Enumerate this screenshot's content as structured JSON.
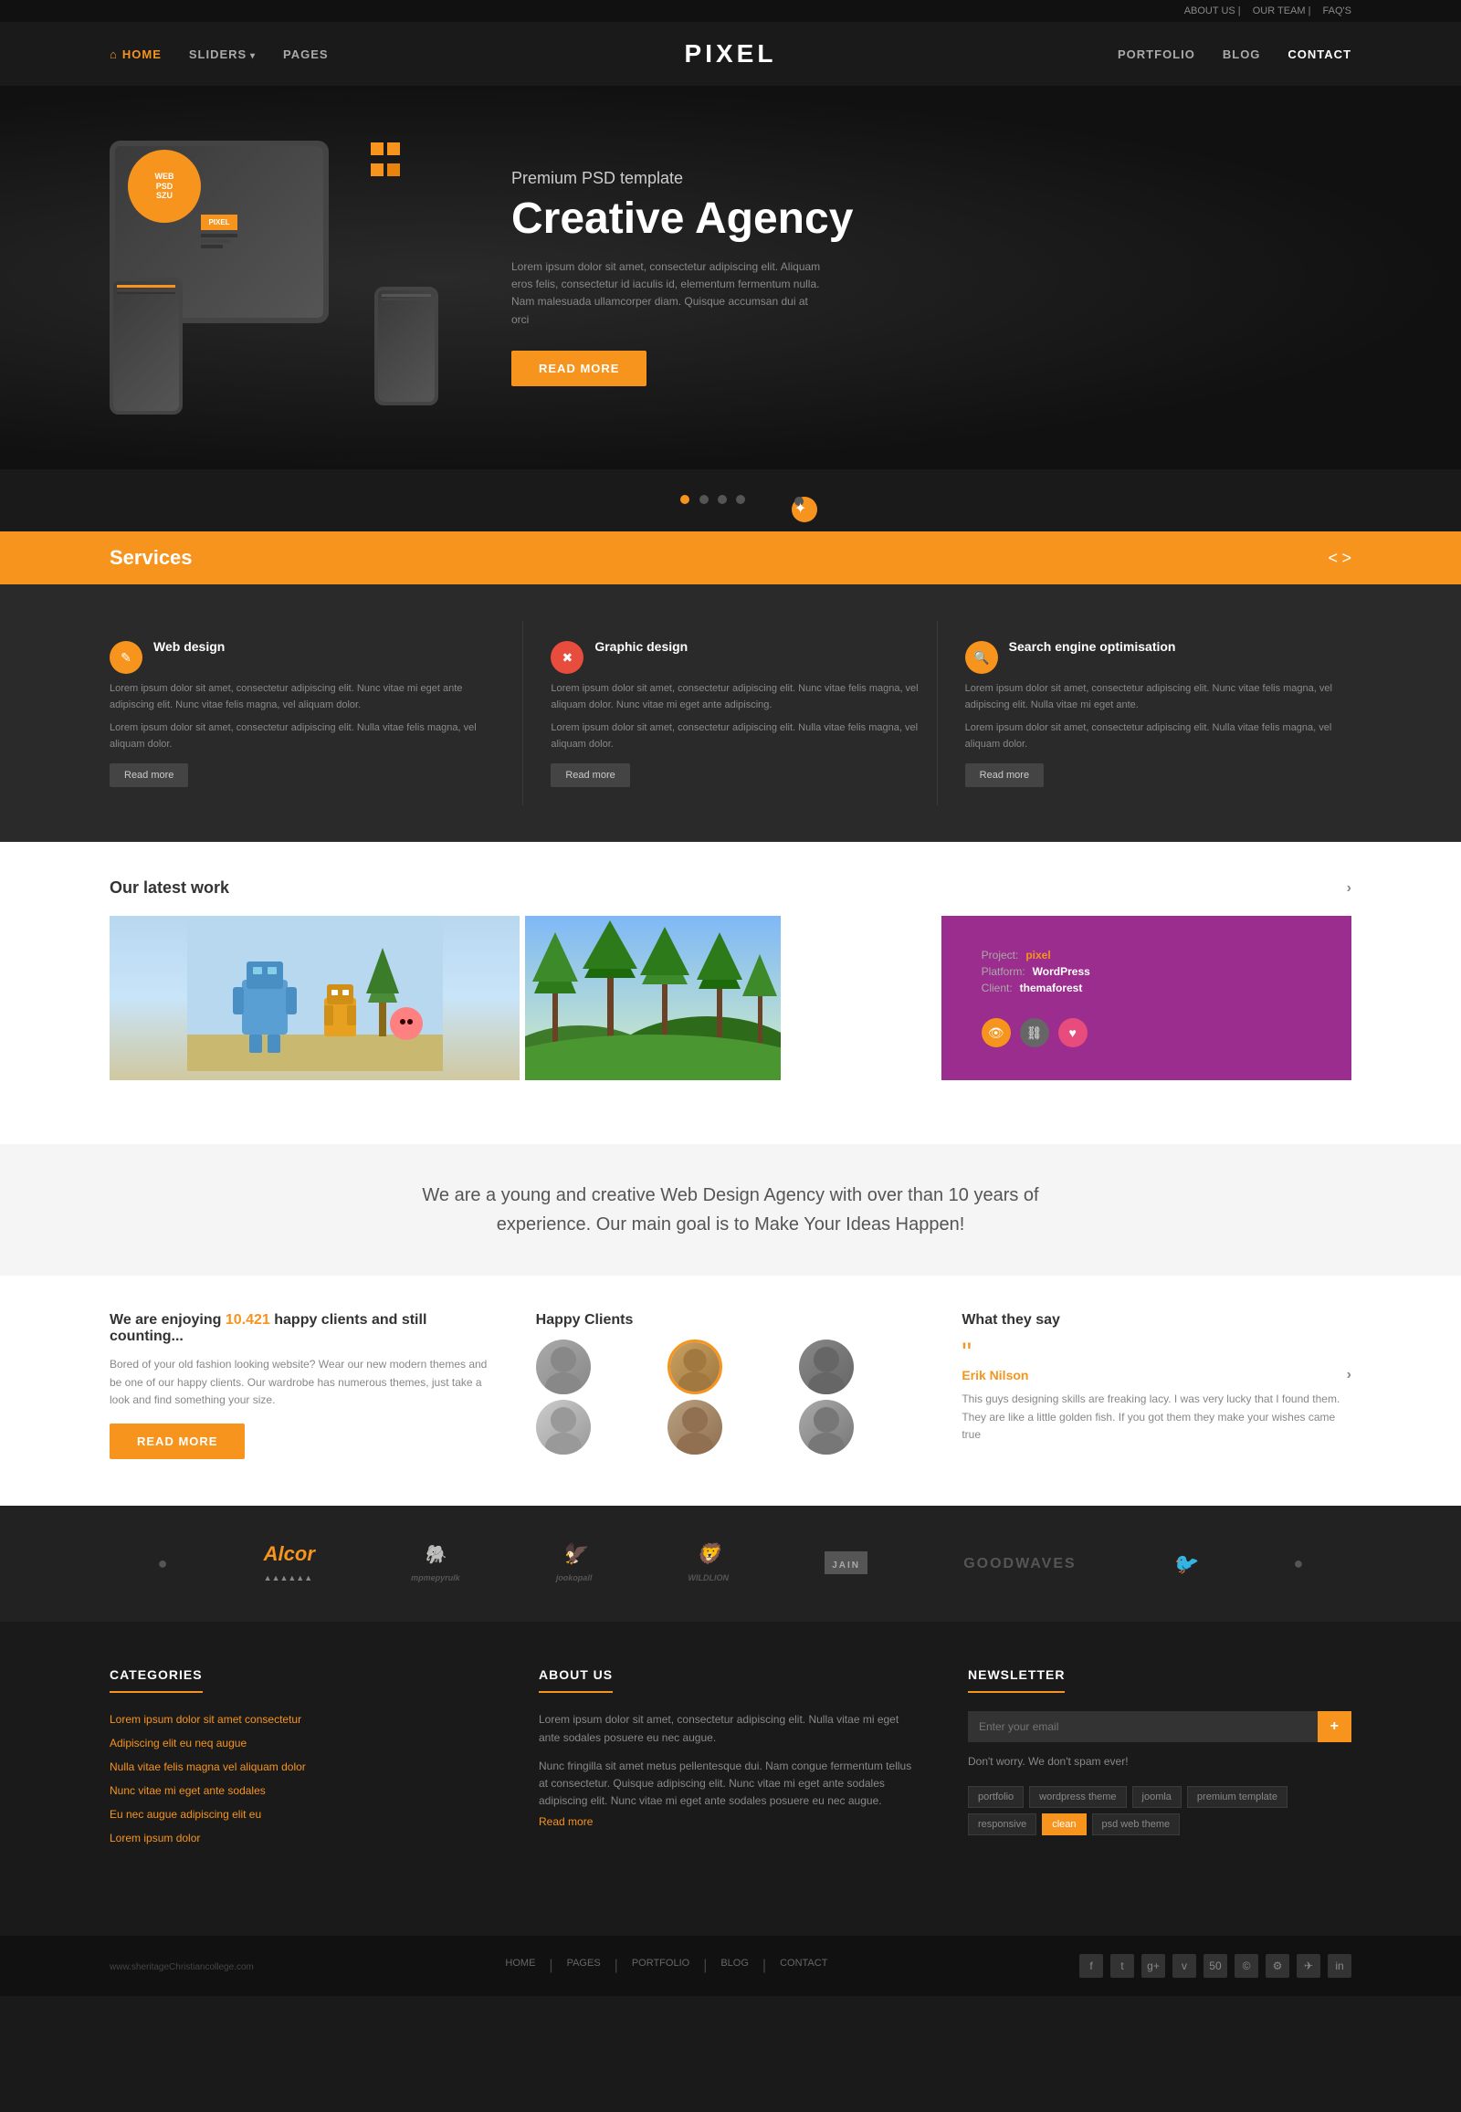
{
  "topbar": {
    "links": [
      "ABOUT US",
      "OUR TEAM",
      "FAQ'S"
    ]
  },
  "nav": {
    "home": "HOME",
    "sliders": "SLIDERS",
    "pages": "PAGES",
    "logo": "PIXEL",
    "portfolio": "PORTFOLIO",
    "blog": "BLOG",
    "contact": "CONTACT"
  },
  "hero": {
    "subtitle": "Premium PSD template",
    "title": "Creative Agency",
    "description": "Lorem ipsum dolor sit amet, consectetur adipiscing elit. Aliquam eros felis, consectetur id iaculis id, elementum fermentum nulla. Nam malesuada ullamcorper diam. Quisque accumsan dui at orci",
    "cta": "READ MORE",
    "badge_line1": "WEB",
    "badge_line2": "PSD",
    "badge_line3": "SZU"
  },
  "slider_dots": [
    "dot1",
    "dot2",
    "dot3",
    "dot4"
  ],
  "services": {
    "title": "Services",
    "nav_prev": "<",
    "nav_next": ">",
    "items": [
      {
        "name": "Web design",
        "icon": "✎",
        "icon_color": "orange",
        "desc1": "Lorem ipsum dolor sit amet, consectetur adipiscing elit. Nunc vitae mi eget ante adipiscing elit. Nunc vitae felis magna, vel aliquam dolor.",
        "desc2": "Lorem ipsum dolor sit amet, consectetur adipiscing elit. Nulla vitae felis magna, vel aliquam dolor.",
        "cta": "Read more"
      },
      {
        "name": "Graphic design",
        "icon": "✖",
        "icon_color": "red",
        "desc1": "Lorem ipsum dolor sit amet, consectetur adipiscing elit. Nunc vitae felis magna, vel aliquam dolor. Nunc vitae mi eget ante adipiscing.",
        "desc2": "Lorem ipsum dolor sit amet, consectetur adipiscing elit. Nulla vitae felis magna, vel aliquam dolor.",
        "cta": "Read more"
      },
      {
        "name": "Search engine optimisation",
        "icon": "🔍",
        "icon_color": "orange",
        "desc1": "Lorem ipsum dolor sit amet, consectetur adipiscing elit. Nunc vitae felis magna, vel adipiscing elit. Nulla vitae mi eget ante.",
        "desc2": "Lorem ipsum dolor sit amet, consectetur adipiscing elit. Nulla vitae felis magna, vel aliquam dolor.",
        "cta": "Read more"
      }
    ]
  },
  "portfolio": {
    "title": "Our latest work",
    "items": [
      {
        "type": "illustration",
        "bg": "robots"
      },
      {
        "type": "illustration",
        "bg": "forest"
      },
      {
        "project_label": "Project:",
        "project_value": "pixel",
        "platform_label": "Platform:",
        "platform_value": "WordPress",
        "client_label": "Client:",
        "client_value": "themaforest"
      }
    ]
  },
  "agency": {
    "bio": "We are a young and creative Web Design Agency with over than 10 years of experience. Our main goal is to Make Your Ideas Happen!"
  },
  "stats": {
    "clients_title": "We are enjoying 10.421 happy clients and still counting...",
    "clients_count": "10.421",
    "clients_desc": "Bored of your old fashion looking website? Wear our new modern themes and be one of our happy clients. Our wardrobe has numerous themes, just take a look and find something your size.",
    "clients_cta": "Read more",
    "happy_clients_title": "Happy Clients",
    "testimonials_title": "What they say",
    "testimonial_name": "Erik Nilson",
    "testimonial_text": "This guys designing skills are freaking lacy. I was very lucky that I found them. They are like a little golden fish. If you got them they make your wishes came true"
  },
  "partners": {
    "logos": [
      "Alcor",
      "mpmepyrulk",
      "jookopall",
      "WILDLION",
      "JAIN",
      "GOODWAVES",
      "🐦"
    ]
  },
  "footer": {
    "categories_title": "CATEGORIES",
    "categories": [
      "Lorem ipsum dolor sit amet consectetur",
      "Adipiscing elit eu neq augue",
      "Nulla vitae felis magna vel aliquam dolor",
      "Nunc vitae mi eget ante sodales",
      "Eu nec augue adipiscing elit eu",
      "Lorem ipsum dolor"
    ],
    "about_title": "ABOUT US",
    "about_text1": "Lorem ipsum dolor sit amet, consectetur adipiscing elit. Nulla vitae mi eget ante sodales posuere eu nec augue.",
    "about_text2": "Nunc fringilla sit amet metus pellentesque dui. Nam congue fermentum tellus at consectetur. Quisque adipiscing elit. Nunc vitae mi eget ante sodales",
    "about_text3_prefix": "adipiscing elit. Nunc vitae mi eget ante sodales posuere eu nec augue.",
    "about_readmore": "Read more",
    "newsletter_title": "NEWSLETTER",
    "newsletter_placeholder": "Enter your email",
    "newsletter_note": "Don't worry. We don't spam ever!",
    "tags": [
      "portfolio",
      "wordpress theme",
      "joomla",
      "premium template",
      "responsive",
      "clean",
      "psd web theme"
    ]
  },
  "footer_bottom": {
    "links": [
      "HOME",
      "PAGES",
      "PORTFOLIO",
      "BLOG",
      "CONTACT"
    ],
    "url": "www.sheritageChristiancollege.com",
    "social": [
      "f",
      "t",
      "g+",
      "v",
      "50",
      "©",
      "⚙",
      "✈",
      "in"
    ]
  }
}
